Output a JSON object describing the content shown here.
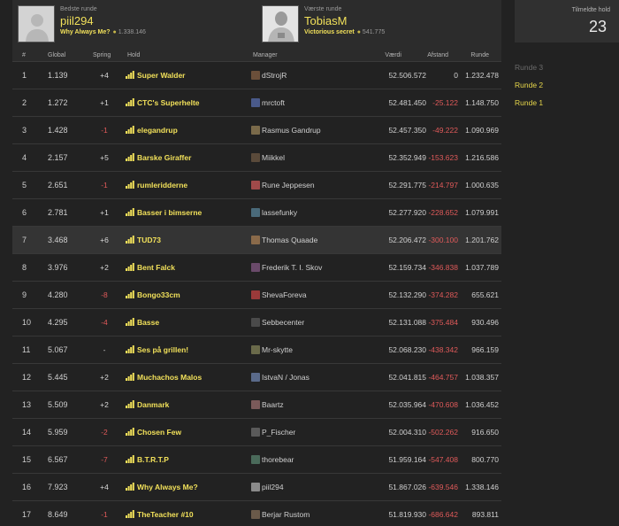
{
  "best": {
    "caption": "Bedste runde",
    "name": "piil294",
    "team": "Why Always Me?",
    "points": "1.338.146"
  },
  "worst": {
    "caption": "Værste runde",
    "name": "TobiasM",
    "team": "Victorious secret",
    "points": "541.775"
  },
  "columns": {
    "rank": "#",
    "global": "Global",
    "spring": "Spring",
    "team": "Hold",
    "manager": "Manager",
    "value": "Værdi",
    "gap": "Afstand",
    "round": "Runde"
  },
  "sidebar": {
    "count_label": "Tilmeldte hold",
    "count_value": "23",
    "rounds": [
      "Runde 3",
      "Runde 2",
      "Runde 1"
    ]
  },
  "colors": {
    "accent_yellow": "#f1e05a",
    "negative_red": "#e05a5a",
    "background": "#222222"
  },
  "rows": [
    {
      "rank": "1",
      "global": "1.139",
      "spring": "+4",
      "team": "Super Walder",
      "manager": "dStrojR",
      "value": "52.506.572",
      "gap": "0",
      "round": "1.232.478"
    },
    {
      "rank": "2",
      "global": "1.272",
      "spring": "+1",
      "team": "CTC's Superhelte",
      "manager": "mrctoft",
      "value": "52.481.450",
      "gap": "-25.122",
      "round": "1.148.750"
    },
    {
      "rank": "3",
      "global": "1.428",
      "spring": "-1",
      "team": "elegandrup",
      "manager": "Rasmus Gandrup",
      "value": "52.457.350",
      "gap": "-49.222",
      "round": "1.090.969"
    },
    {
      "rank": "4",
      "global": "2.157",
      "spring": "+5",
      "team": "Barske Giraffer",
      "manager": "Miikkel",
      "value": "52.352.949",
      "gap": "-153.623",
      "round": "1.216.586"
    },
    {
      "rank": "5",
      "global": "2.651",
      "spring": "-1",
      "team": "rumleridderne",
      "manager": "Rune Jeppesen",
      "value": "52.291.775",
      "gap": "-214.797",
      "round": "1.000.635"
    },
    {
      "rank": "6",
      "global": "2.781",
      "spring": "+1",
      "team": "Basser i bimserne",
      "manager": "lassefunky",
      "value": "52.277.920",
      "gap": "-228.652",
      "round": "1.079.991"
    },
    {
      "rank": "7",
      "global": "3.468",
      "spring": "+6",
      "team": "TUD73",
      "manager": "Thomas Quaade",
      "value": "52.206.472",
      "gap": "-300.100",
      "round": "1.201.762"
    },
    {
      "rank": "8",
      "global": "3.976",
      "spring": "+2",
      "team": "Bent Falck",
      "manager": "Frederik T. I. Skov",
      "value": "52.159.734",
      "gap": "-346.838",
      "round": "1.037.789"
    },
    {
      "rank": "9",
      "global": "4.280",
      "spring": "-8",
      "team": "Bongo33cm",
      "manager": "ShevaForeva",
      "value": "52.132.290",
      "gap": "-374.282",
      "round": "655.621"
    },
    {
      "rank": "10",
      "global": "4.295",
      "spring": "-4",
      "team": "Basse",
      "manager": "Sebbecenter",
      "value": "52.131.088",
      "gap": "-375.484",
      "round": "930.496"
    },
    {
      "rank": "11",
      "global": "5.067",
      "spring": "-",
      "team": "Ses på grillen!",
      "manager": "Mr-skytte",
      "value": "52.068.230",
      "gap": "-438.342",
      "round": "966.159"
    },
    {
      "rank": "12",
      "global": "5.445",
      "spring": "+2",
      "team": "Muchachos Malos",
      "manager": "IstvaN / Jonas",
      "value": "52.041.815",
      "gap": "-464.757",
      "round": "1.038.357"
    },
    {
      "rank": "13",
      "global": "5.509",
      "spring": "+2",
      "team": "Danmark",
      "manager": "Baartz",
      "value": "52.035.964",
      "gap": "-470.608",
      "round": "1.036.452"
    },
    {
      "rank": "14",
      "global": "5.959",
      "spring": "-2",
      "team": "Chosen Few",
      "manager": "P_Fischer",
      "value": "52.004.310",
      "gap": "-502.262",
      "round": "916.650"
    },
    {
      "rank": "15",
      "global": "6.567",
      "spring": "-7",
      "team": "B.T.R.T.P",
      "manager": "thorebear",
      "value": "51.959.164",
      "gap": "-547.408",
      "round": "800.770"
    },
    {
      "rank": "16",
      "global": "7.923",
      "spring": "+4",
      "team": "Why Always Me?",
      "manager": "piil294",
      "value": "51.867.026",
      "gap": "-639.546",
      "round": "1.338.146"
    },
    {
      "rank": "17",
      "global": "8.649",
      "spring": "-1",
      "team": "TheTeacher #10",
      "manager": "Berjar Rustom",
      "value": "51.819.930",
      "gap": "-686.642",
      "round": "893.811"
    }
  ]
}
